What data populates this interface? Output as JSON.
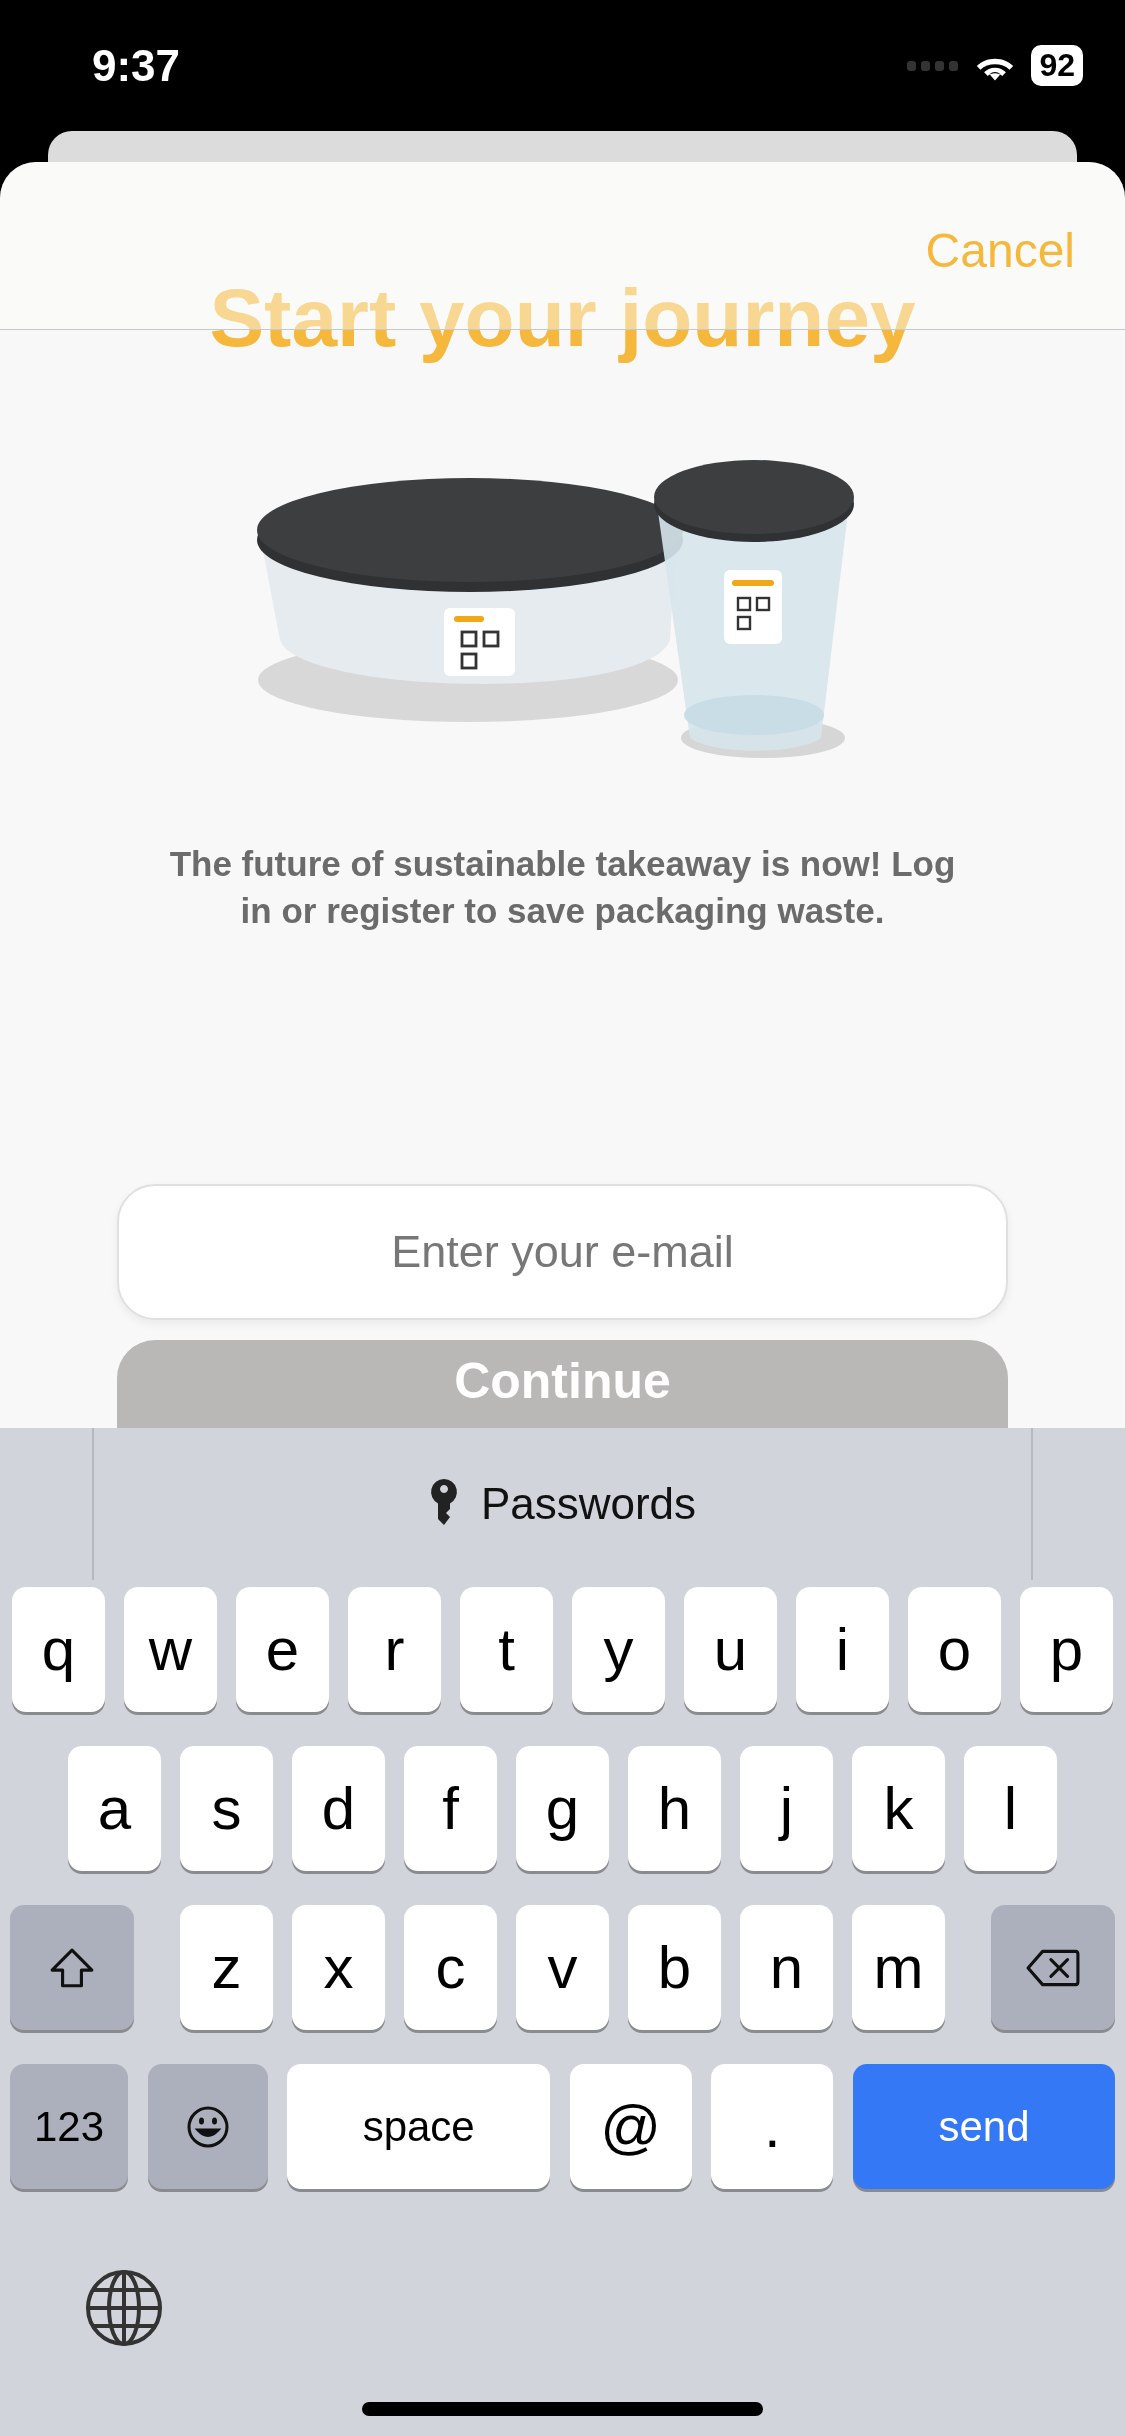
{
  "status_bar": {
    "time": "9:37",
    "battery": "92"
  },
  "header": {
    "cancel": "Cancel"
  },
  "title": "Start your journey",
  "description": "The future of sustainable takeaway is now! Log in or register to save packaging waste.",
  "email_field": {
    "placeholder": "Enter your e-mail"
  },
  "continue_button": {
    "label": "Continue",
    "disabled": true
  },
  "keyboard": {
    "suggestion": "Passwords",
    "rows": [
      {
        "keys": [
          {
            "kind": "letter",
            "label": "q"
          },
          {
            "kind": "letter",
            "label": "w"
          },
          {
            "kind": "letter",
            "label": "e"
          },
          {
            "kind": "letter",
            "label": "r"
          },
          {
            "kind": "letter",
            "label": "t"
          },
          {
            "kind": "letter",
            "label": "y"
          },
          {
            "kind": "letter",
            "label": "u"
          },
          {
            "kind": "letter",
            "label": "i"
          },
          {
            "kind": "letter",
            "label": "o"
          },
          {
            "kind": "letter",
            "label": "p"
          }
        ]
      },
      {
        "keys": [
          {
            "kind": "letter",
            "label": "a"
          },
          {
            "kind": "letter",
            "label": "s"
          },
          {
            "kind": "letter",
            "label": "d"
          },
          {
            "kind": "letter",
            "label": "f"
          },
          {
            "kind": "letter",
            "label": "g"
          },
          {
            "kind": "letter",
            "label": "h"
          },
          {
            "kind": "letter",
            "label": "j"
          },
          {
            "kind": "letter",
            "label": "k"
          },
          {
            "kind": "letter",
            "label": "l"
          }
        ]
      },
      {
        "keys": [
          {
            "kind": "shift"
          },
          {
            "kind": "letter",
            "label": "z"
          },
          {
            "kind": "letter",
            "label": "x"
          },
          {
            "kind": "letter",
            "label": "c"
          },
          {
            "kind": "letter",
            "label": "v"
          },
          {
            "kind": "letter",
            "label": "b"
          },
          {
            "kind": "letter",
            "label": "n"
          },
          {
            "kind": "letter",
            "label": "m"
          },
          {
            "kind": "delete"
          }
        ]
      },
      {
        "keys": [
          {
            "kind": "numbers",
            "label": "123"
          },
          {
            "kind": "emoji"
          },
          {
            "kind": "space",
            "label": "space"
          },
          {
            "kind": "letter",
            "label": "@"
          },
          {
            "kind": "letter",
            "label": "."
          },
          {
            "kind": "send",
            "label": "send"
          }
        ]
      }
    ]
  }
}
